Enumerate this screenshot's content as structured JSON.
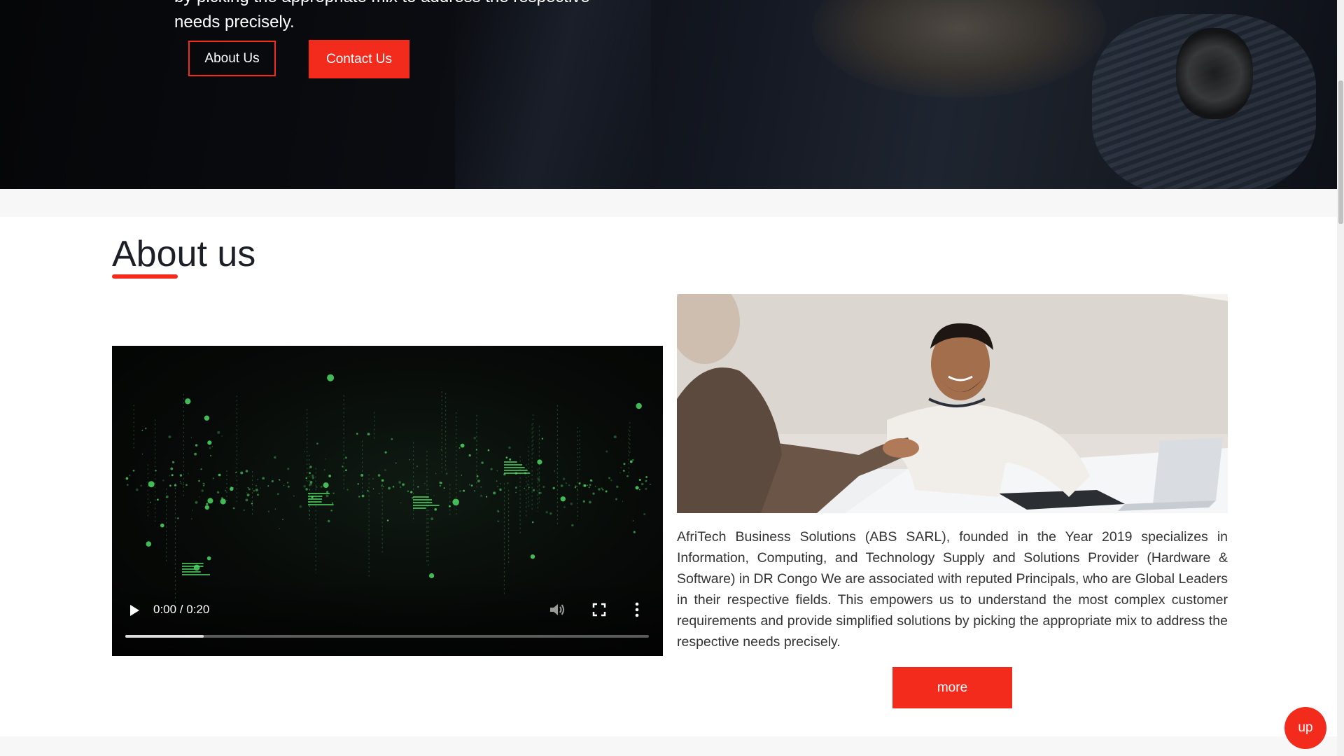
{
  "hero": {
    "text_line1": "by picking the appropriate mix to address the respective",
    "text_line2": "needs precisely.",
    "about_button": "About Us",
    "contact_button": "Contact Us"
  },
  "about": {
    "title": "About us",
    "video": {
      "time": "0:00 / 0:20",
      "progress": 0.15
    },
    "paragraph": "AfriTech Business Solutions (ABS SARL), founded in the Year 2019 specializes in Information, Computing, and Technology Supply and Solutions Provider (Hardware & Software) in DR Congo We are associated with reputed Principals, who are Global Leaders in their respective fields. This empowers us to understand the most complex customer requirements and provide simplified solutions by picking the appropriate mix to address the respective needs precisely.",
    "more_button": "more"
  },
  "up_button": "up",
  "colors": {
    "accent": "#f22b1c",
    "hero_bg": "#0b0d12",
    "band": "#f7f7f7",
    "video_green": "#4cd964"
  },
  "icons": {
    "play": "play-icon",
    "volume": "volume-icon",
    "fullscreen": "fullscreen-icon",
    "menu": "kebab-menu-icon"
  }
}
